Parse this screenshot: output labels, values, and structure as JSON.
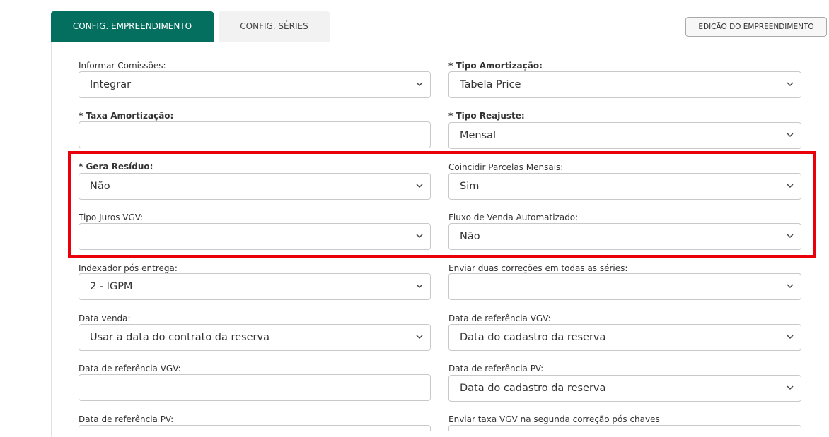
{
  "tabs": {
    "active": "CONFIG. EMPREENDIMENTO",
    "inactive": "CONFIG. SÉRIES"
  },
  "edit_button": "EDIÇÃO DO EMPREENDIMENTO",
  "form": {
    "informar_comissoes": {
      "label": "Informar Comissões:",
      "value": "Integrar"
    },
    "tipo_amortizacao": {
      "label": "* Tipo Amortização:",
      "value": "Tabela Price"
    },
    "taxa_amortizacao": {
      "label": "* Taxa Amortização:",
      "value": ""
    },
    "tipo_reajuste": {
      "label": "* Tipo Reajuste:",
      "value": "Mensal"
    },
    "gera_residuo": {
      "label": "* Gera Resíduo:",
      "value": "Não"
    },
    "coincidir_parcelas": {
      "label": "Coincidir Parcelas Mensais:",
      "value": "Sim"
    },
    "tipo_juros_vgv": {
      "label": "Tipo Juros VGV:",
      "value": ""
    },
    "fluxo_venda": {
      "label": "Fluxo de Venda Automatizado:",
      "value": "Não"
    },
    "indexador_pos_entrega": {
      "label": "Indexador pós entrega:",
      "value": "2 - IGPM"
    },
    "enviar_duas_correcoes": {
      "label": "Enviar duas correções em todas as séries:",
      "value": ""
    },
    "data_venda": {
      "label": "Data venda:",
      "value": "Usar a data do contrato da reserva"
    },
    "data_ref_vgv_select": {
      "label": "Data de referência VGV:",
      "value": "Data do cadastro da reserva"
    },
    "data_ref_vgv_input": {
      "label": "Data de referência VGV:",
      "value": ""
    },
    "data_ref_pv_select": {
      "label": "Data de referência PV:",
      "value": "Data do cadastro da reserva"
    },
    "data_ref_pv_bottom": {
      "label": "Data de referência PV:"
    },
    "enviar_taxa_vgv": {
      "label": "Enviar taxa VGV na segunda correção pós chaves"
    }
  },
  "colors": {
    "accent": "#046e5f",
    "highlight": "#e8000b"
  },
  "icons": {
    "select_arrow": "chevron-down-icon"
  }
}
